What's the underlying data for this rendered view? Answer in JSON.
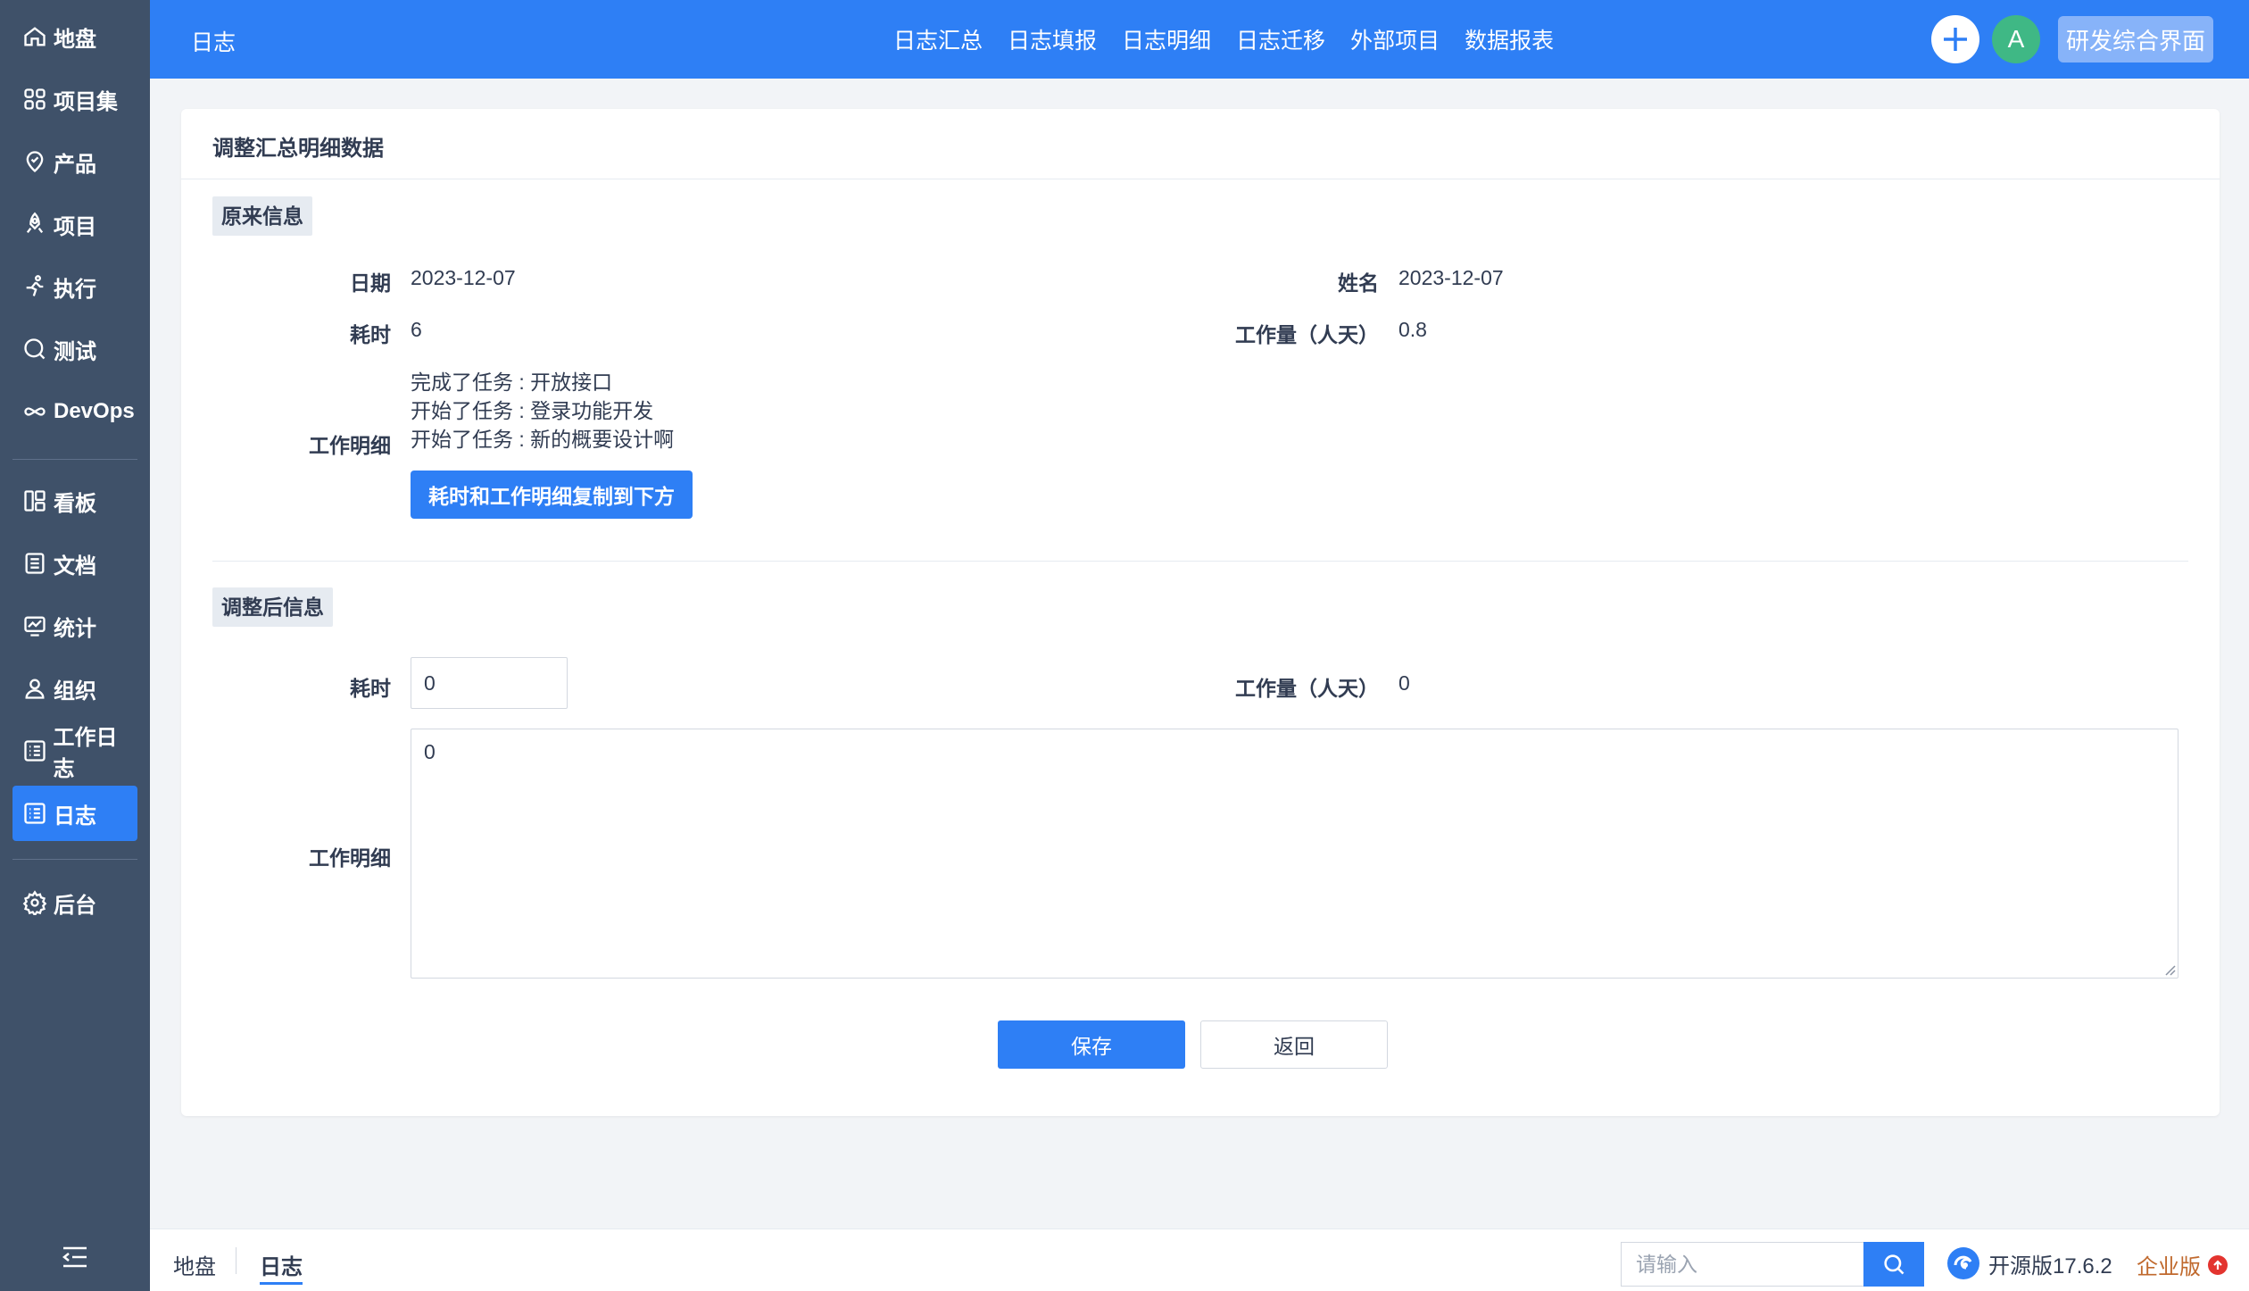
{
  "sidebar": {
    "items": [
      {
        "label": "地盘",
        "icon": "home-icon"
      },
      {
        "label": "项目集",
        "icon": "grid-icon"
      },
      {
        "label": "产品",
        "icon": "product-icon"
      },
      {
        "label": "项目",
        "icon": "rocket-icon"
      },
      {
        "label": "执行",
        "icon": "run-icon"
      },
      {
        "label": "测试",
        "icon": "test-icon"
      },
      {
        "label": "DevOps",
        "icon": "infinity-icon"
      },
      {
        "label": "看板",
        "icon": "kanban-icon"
      },
      {
        "label": "文档",
        "icon": "doc-icon"
      },
      {
        "label": "统计",
        "icon": "chart-icon"
      },
      {
        "label": "组织",
        "icon": "user-icon"
      },
      {
        "label": "工作日志",
        "icon": "list-icon"
      },
      {
        "label": "日志",
        "icon": "list-icon",
        "active": true
      },
      {
        "label": "后台",
        "icon": "gear-icon"
      }
    ]
  },
  "header": {
    "title": "日志",
    "tabs": [
      "日志汇总",
      "日志填报",
      "日志明细",
      "日志迁移",
      "外部项目",
      "数据报表"
    ],
    "avatar": "A",
    "switch_label": "研发综合界面"
  },
  "card": {
    "title": "调整汇总明细数据",
    "original": {
      "section_label": "原来信息",
      "date_label": "日期",
      "date_value": "2023-12-07",
      "name_label": "姓名",
      "name_value": "2023-12-07",
      "hours_label": "耗时",
      "hours_value": "6",
      "workload_label": "工作量（人天）",
      "workload_value": "0.8",
      "detail_label": "工作明细",
      "detail_lines": [
        "完成了任务 : 开放接口",
        "开始了任务 : 登录功能开发",
        "开始了任务 : 新的概要设计啊"
      ],
      "copy_button": "耗时和工作明细复制到下方"
    },
    "adjusted": {
      "section_label": "调整后信息",
      "hours_label": "耗时",
      "hours_value": "0",
      "workload_label": "工作量（人天）",
      "workload_value": "0",
      "detail_label": "工作明细",
      "detail_value": "0"
    },
    "save_button": "保存",
    "back_button": "返回"
  },
  "footer": {
    "breadcrumbs": [
      "地盘",
      "日志"
    ],
    "search_placeholder": "请输入",
    "edition": "开源版17.6.2",
    "enterprise": "企业版"
  },
  "colors": {
    "accent": "#2e7ff5",
    "sidebar_bg": "#3f5169",
    "avatar_bg": "#3fb885",
    "enterprise": "#c0692d"
  }
}
